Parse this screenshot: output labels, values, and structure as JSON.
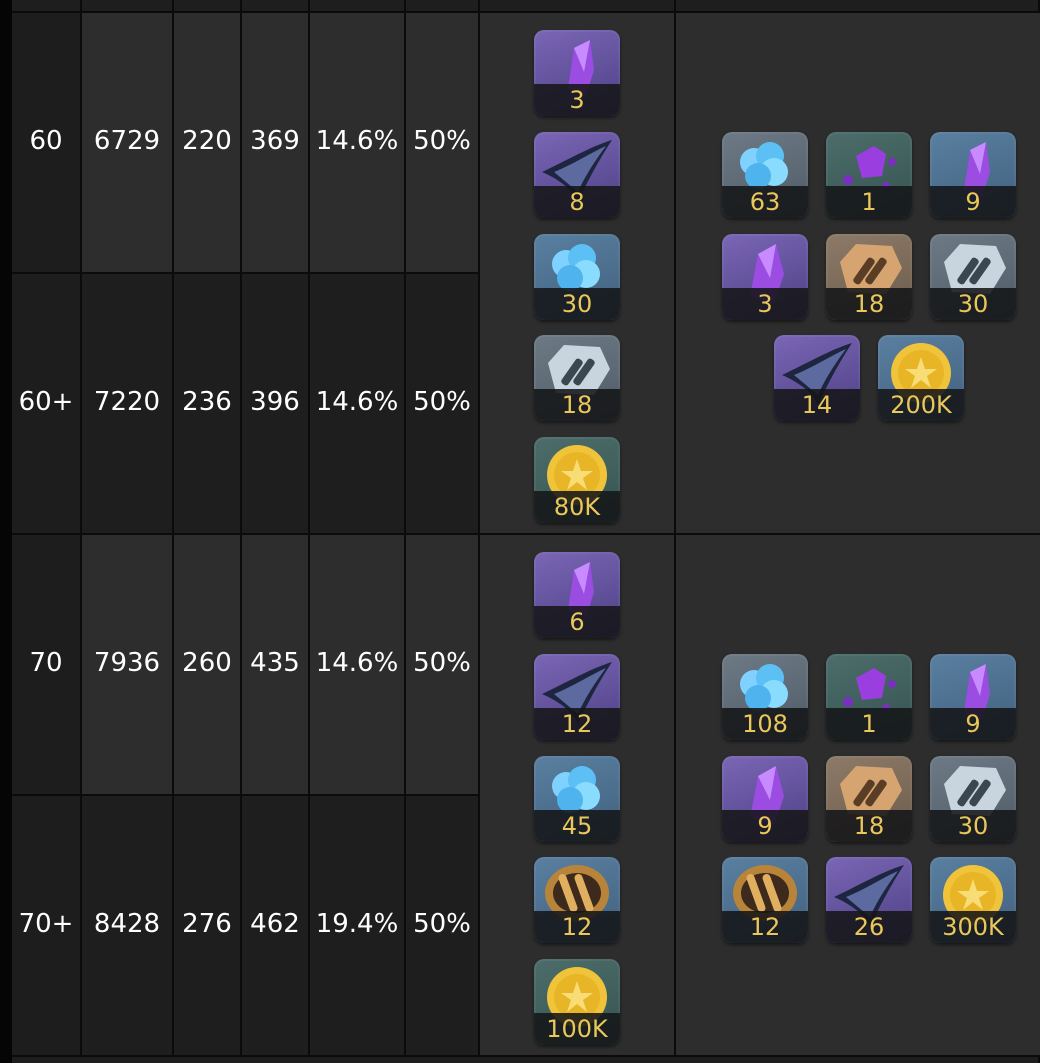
{
  "rows": [
    {
      "level": "60",
      "hp": "6729",
      "atk": "220",
      "def": "369",
      "crit": "14.6%",
      "critdmg": "50%"
    },
    {
      "level": "60+",
      "hp": "7220",
      "atk": "236",
      "def": "396",
      "crit": "14.6%",
      "critdmg": "50%"
    },
    {
      "level": "70",
      "hp": "7936",
      "atk": "260",
      "def": "435",
      "crit": "14.6%",
      "critdmg": "50%"
    },
    {
      "level": "70+",
      "hp": "8428",
      "atk": "276",
      "def": "462",
      "crit": "19.4%",
      "critdmg": "50%"
    }
  ],
  "ascension": [
    {
      "materials": [
        {
          "icon": "purple-crystal-icon",
          "qty": "3"
        },
        {
          "icon": "dark-feather-icon",
          "qty": "8"
        },
        {
          "icon": "blue-flower-icon",
          "qty": "30"
        },
        {
          "icon": "silver-emblem-icon",
          "qty": "18"
        },
        {
          "icon": "gold-coin-icon",
          "qty": "80K"
        }
      ],
      "totals": [
        {
          "icon": "blue-flower-icon",
          "qty": "63"
        },
        {
          "icon": "purple-shard-icon",
          "qty": "1"
        },
        {
          "icon": "purple-crystal-icon",
          "qty": "9"
        },
        {
          "icon": "purple-crystal-icon",
          "qty": "3"
        },
        {
          "icon": "bronze-emblem-icon",
          "qty": "18"
        },
        {
          "icon": "silver-emblem-icon",
          "qty": "30"
        },
        {
          "icon": "dark-feather-icon",
          "qty": "14"
        },
        {
          "icon": "gold-coin-icon",
          "qty": "200K"
        }
      ]
    },
    {
      "materials": [
        {
          "icon": "purple-crystal-icon",
          "qty": "6"
        },
        {
          "icon": "dark-feather-icon",
          "qty": "12"
        },
        {
          "icon": "blue-flower-icon",
          "qty": "45"
        },
        {
          "icon": "gold-emblem-icon",
          "qty": "12"
        },
        {
          "icon": "gold-coin-icon",
          "qty": "100K"
        }
      ],
      "totals": [
        {
          "icon": "blue-flower-icon",
          "qty": "108"
        },
        {
          "icon": "purple-shard-icon",
          "qty": "1"
        },
        {
          "icon": "purple-crystal-icon",
          "qty": "9"
        },
        {
          "icon": "purple-crystal-icon",
          "qty": "9"
        },
        {
          "icon": "bronze-emblem-icon",
          "qty": "18"
        },
        {
          "icon": "silver-emblem-icon",
          "qty": "30"
        },
        {
          "icon": "gold-emblem-icon",
          "qty": "12"
        },
        {
          "icon": "dark-feather-icon",
          "qty": "26"
        },
        {
          "icon": "gold-coin-icon",
          "qty": "300K"
        }
      ]
    }
  ],
  "colors": {
    "qty": "#e9c75a",
    "text": "#ffffff"
  }
}
